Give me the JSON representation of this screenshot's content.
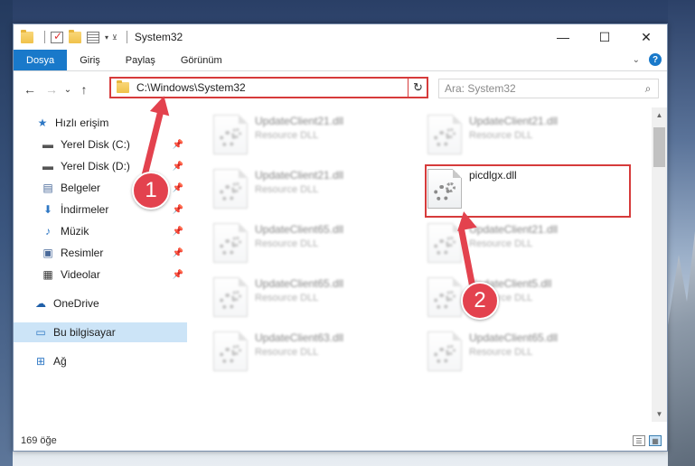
{
  "window": {
    "title": "System32",
    "controls": {
      "minimize": "—",
      "maximize": "☐",
      "close": "✕"
    }
  },
  "ribbon": {
    "tabs": [
      "Dosya",
      "Giriş",
      "Paylaş",
      "Görünüm"
    ],
    "help": "?"
  },
  "nav": {
    "back": "←",
    "forward": "→",
    "recent": "⌄",
    "up": "↑",
    "address": "C:\\Windows\\System32",
    "search_placeholder": "Ara: System32"
  },
  "sidebar": {
    "items": [
      {
        "label": "Hızlı erişim",
        "icon": "star-icon"
      },
      {
        "label": "Yerel Disk (C:)",
        "icon": "drive-icon"
      },
      {
        "label": "Yerel Disk (D:)",
        "icon": "drive-icon"
      },
      {
        "label": "Belgeler",
        "icon": "documents-icon"
      },
      {
        "label": "İndirmeler",
        "icon": "download-icon"
      },
      {
        "label": "Müzik",
        "icon": "music-icon"
      },
      {
        "label": "Resimler",
        "icon": "pictures-icon"
      },
      {
        "label": "Videolar",
        "icon": "video-icon"
      },
      {
        "label": "OneDrive",
        "icon": "cloud-icon"
      },
      {
        "label": "Bu bilgisayar",
        "icon": "computer-icon"
      },
      {
        "label": "Ağ",
        "icon": "network-icon"
      }
    ]
  },
  "files": [
    {
      "name": "UpdateClient21.dll",
      "type": "Resource DLL"
    },
    {
      "name": "UpdateClient21.dll",
      "type": "Resource DLL"
    },
    {
      "name": "UpdateClient21.dll",
      "type": "Resource DLL"
    },
    {
      "name": "picdlgx.dll",
      "type": ""
    },
    {
      "name": "UpdateClient65.dll",
      "type": "Resource DLL"
    },
    {
      "name": "UpdateClient21.dll",
      "type": "Resource DLL"
    },
    {
      "name": "UpdateClient65.dll",
      "type": "Resource DLL"
    },
    {
      "name": "UpdateClient5.dll",
      "type": "Resource DLL"
    },
    {
      "name": "UpdateClient63.dll",
      "type": "Resource DLL"
    },
    {
      "name": "UpdateClient65.dll",
      "type": "Resource DLL"
    }
  ],
  "status": {
    "count": "169 öğe"
  },
  "annotations": {
    "badge1": "1",
    "badge2": "2"
  },
  "colors": {
    "accent": "#1979ca",
    "annotation": "#e3424e",
    "selected": "#cce4f7"
  }
}
